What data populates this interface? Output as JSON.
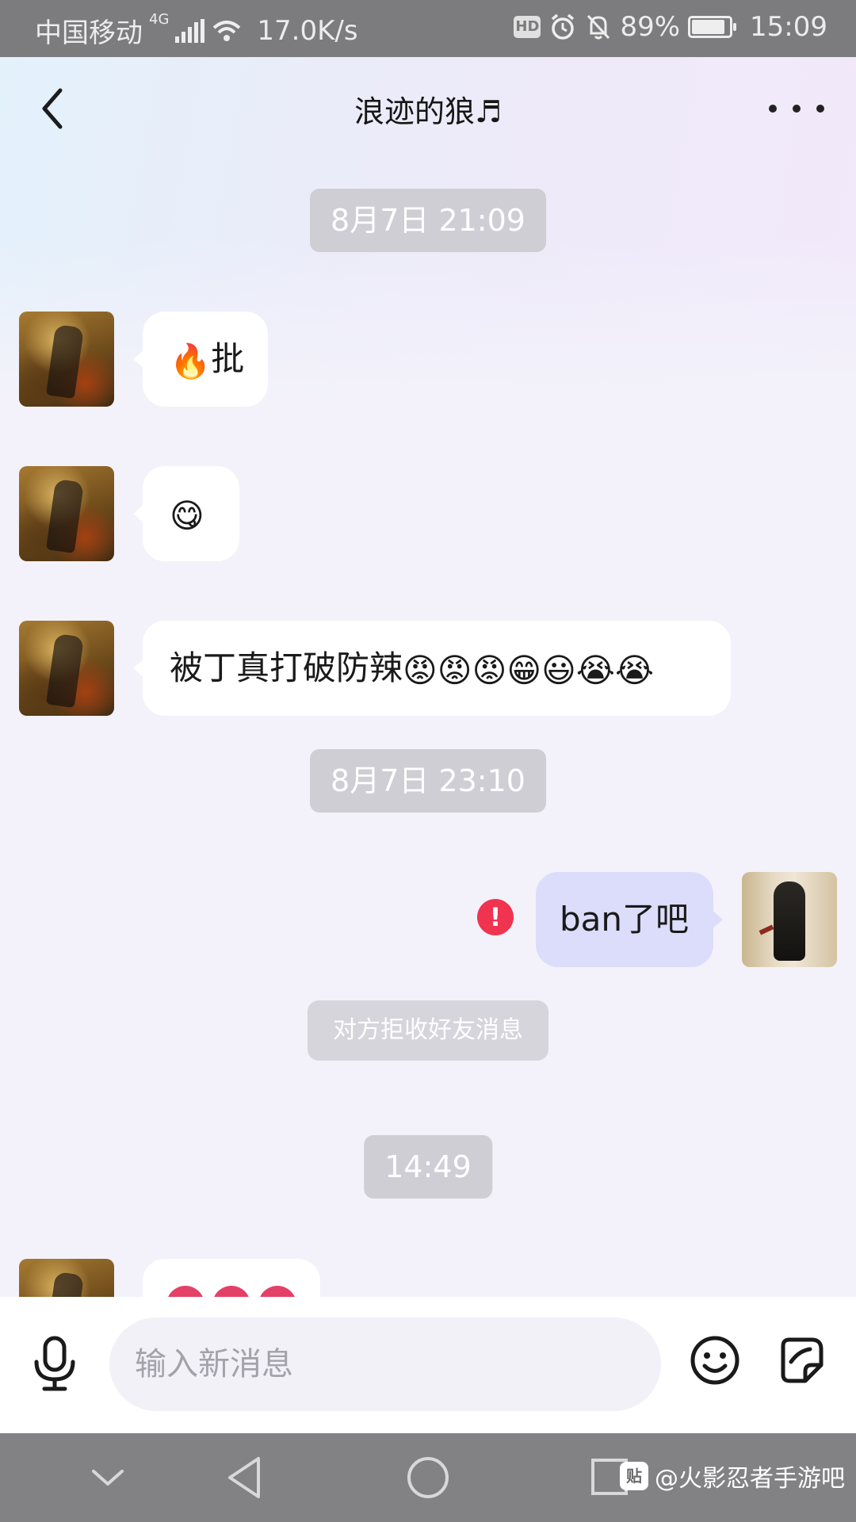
{
  "status_bar": {
    "carrier": "中国移动",
    "network_type": "4G",
    "speed": "17.0K/s",
    "hd_label": "HD",
    "battery": "89%",
    "battery_level": 0.89,
    "time": "15:09"
  },
  "header": {
    "title": "浪迹的狼♬"
  },
  "messages": {
    "timestamp_1": "8月7日 21:09",
    "msg_1_text": "批",
    "msg_1_emoji": "🔥",
    "msg_2_emoji": "😋",
    "msg_3_text": "被丁真打破防辣",
    "msg_3_emojis": "😡😡😡😁😃😭😭",
    "timestamp_2": "8月7日 23:10",
    "msg_4_text": "ban了吧",
    "error_mark": "!",
    "system_notice": "对方拒收好友消息",
    "timestamp_3": "14:49"
  },
  "input_bar": {
    "placeholder": "输入新消息"
  },
  "watermark": {
    "badge": "贴",
    "text": "@火影忍者手游吧"
  },
  "colors": {
    "sent_bubble": "#dcdcfb",
    "received_bubble": "#ffffff",
    "error_red": "#f0344f",
    "timestamp_bg": "#cfced5"
  }
}
